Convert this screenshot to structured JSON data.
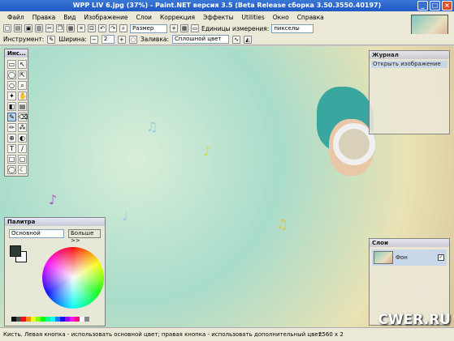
{
  "window": {
    "title": "WPP LIV 6.jpg (37%) - Paint.NET версия 3.5 (Beta Release сборка 3.50.3550.40197)",
    "min": "_",
    "max": "□",
    "close": "×"
  },
  "menu": [
    "Файл",
    "Правка",
    "Вид",
    "Изображение",
    "Слои",
    "Коррекция",
    "Эффекты",
    "Utilities",
    "Окно",
    "Справка"
  ],
  "toolbar": {
    "zoom_value": "Размер окн",
    "units_label": "Единицы измерения:",
    "units_value": "пикселы"
  },
  "toolbar2": {
    "tool_label": "Инструмент:",
    "width_label": "Ширина:",
    "width_value": "2",
    "fill_label": "Заливка:",
    "fill_value": "Сплошной цвет"
  },
  "tools_panel": {
    "title": "Инс..."
  },
  "history_panel": {
    "title": "Журнал",
    "item": "Открыть изображение"
  },
  "layers_panel": {
    "title": "Слои",
    "layer_name": "Фон"
  },
  "palette_panel": {
    "title": "Палитра",
    "mode": "Основной",
    "more_button": "Больше >>"
  },
  "status": {
    "hint": "Кисть. Левая кнопка - использовать основной цвет; правая кнопка - использовать дополнительный цвет.",
    "size": "2560 x 2",
    "watermark": "CWER.RU"
  },
  "colors": {
    "title_bar": "#1f58c2",
    "panel_bg": "#ece9d8",
    "accent": "#3163b4"
  }
}
